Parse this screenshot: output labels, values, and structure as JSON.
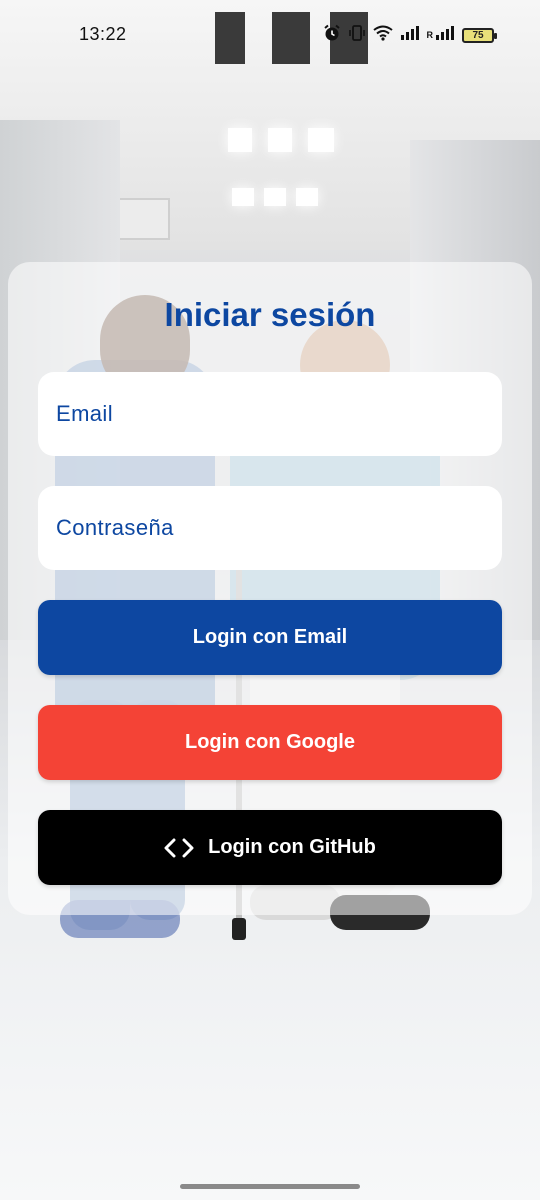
{
  "status_bar": {
    "time": "13:22",
    "network_label": "R",
    "battery_level": "75",
    "icons": [
      "alarm-icon",
      "vibrate-icon",
      "wifi-icon",
      "signal-icon",
      "signal-roaming-icon",
      "battery-icon"
    ]
  },
  "login": {
    "title": "Iniciar sesión",
    "email_placeholder": "Email",
    "password_placeholder": "Contraseña",
    "email_button": "Login con Email",
    "google_button": "Login con Google",
    "github_button": "Login con GitHub",
    "github_icon": "code-icon"
  },
  "colors": {
    "primary": "#0d47a1",
    "google": "#f44336",
    "github": "#000000",
    "input_bg": "#ffffff"
  }
}
